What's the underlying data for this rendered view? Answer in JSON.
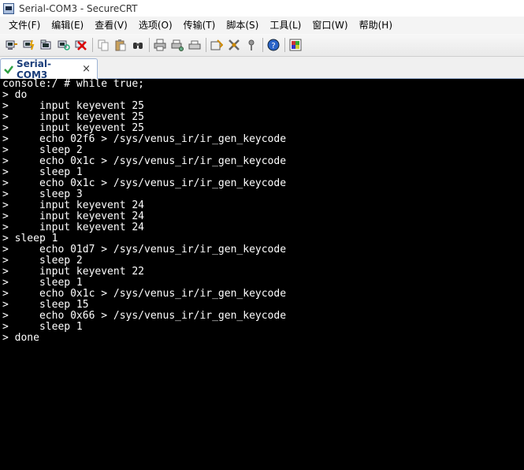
{
  "window": {
    "title": "Serial-COM3 - SecureCRT",
    "app_icon": "securecrt-app-icon"
  },
  "menu": {
    "items": [
      "文件(F)",
      "编辑(E)",
      "查看(V)",
      "选项(O)",
      "传输(T)",
      "脚本(S)",
      "工具(L)",
      "窗口(W)",
      "帮助(H)"
    ]
  },
  "toolbar": {
    "icons": [
      "connect-icon",
      "quick-connect-icon",
      "connect-in-tab-icon",
      "reconnect-icon",
      "disconnect-icon",
      "copy-icon",
      "paste-icon",
      "find-icon",
      "print-icon",
      "print-setup-icon",
      "print-screen-icon",
      "session-options-icon",
      "global-options-icon",
      "keymap-icon",
      "help-icon",
      "sftp-icon"
    ]
  },
  "tabs": [
    {
      "label": "Serial-COM3",
      "close": "×",
      "status_color": "#2ea043"
    }
  ],
  "terminal": {
    "background": "#000000",
    "foreground": "#ffffff",
    "lines": [
      "console:/ # while true;",
      "> do",
      ">     input keyevent 25",
      ">     input keyevent 25",
      ">     input keyevent 25",
      ">     echo 02f6 > /sys/venus_ir/ir_gen_keycode",
      ">     sleep 2",
      ">     echo 0x1c > /sys/venus_ir/ir_gen_keycode",
      ">     sleep 1",
      ">     echo 0x1c > /sys/venus_ir/ir_gen_keycode",
      ">     sleep 3",
      ">     input keyevent 24",
      ">     input keyevent 24",
      ">     input keyevent 24",
      "> sleep 1",
      ">     echo 01d7 > /sys/venus_ir/ir_gen_keycode",
      ">     sleep 2",
      ">     input keyevent 22",
      ">     sleep 1",
      ">     echo 0x1c > /sys/venus_ir/ir_gen_keycode",
      ">     sleep 15",
      ">     echo 0x66 > /sys/venus_ir/ir_gen_keycode",
      ">     sleep 1",
      "> done"
    ]
  }
}
